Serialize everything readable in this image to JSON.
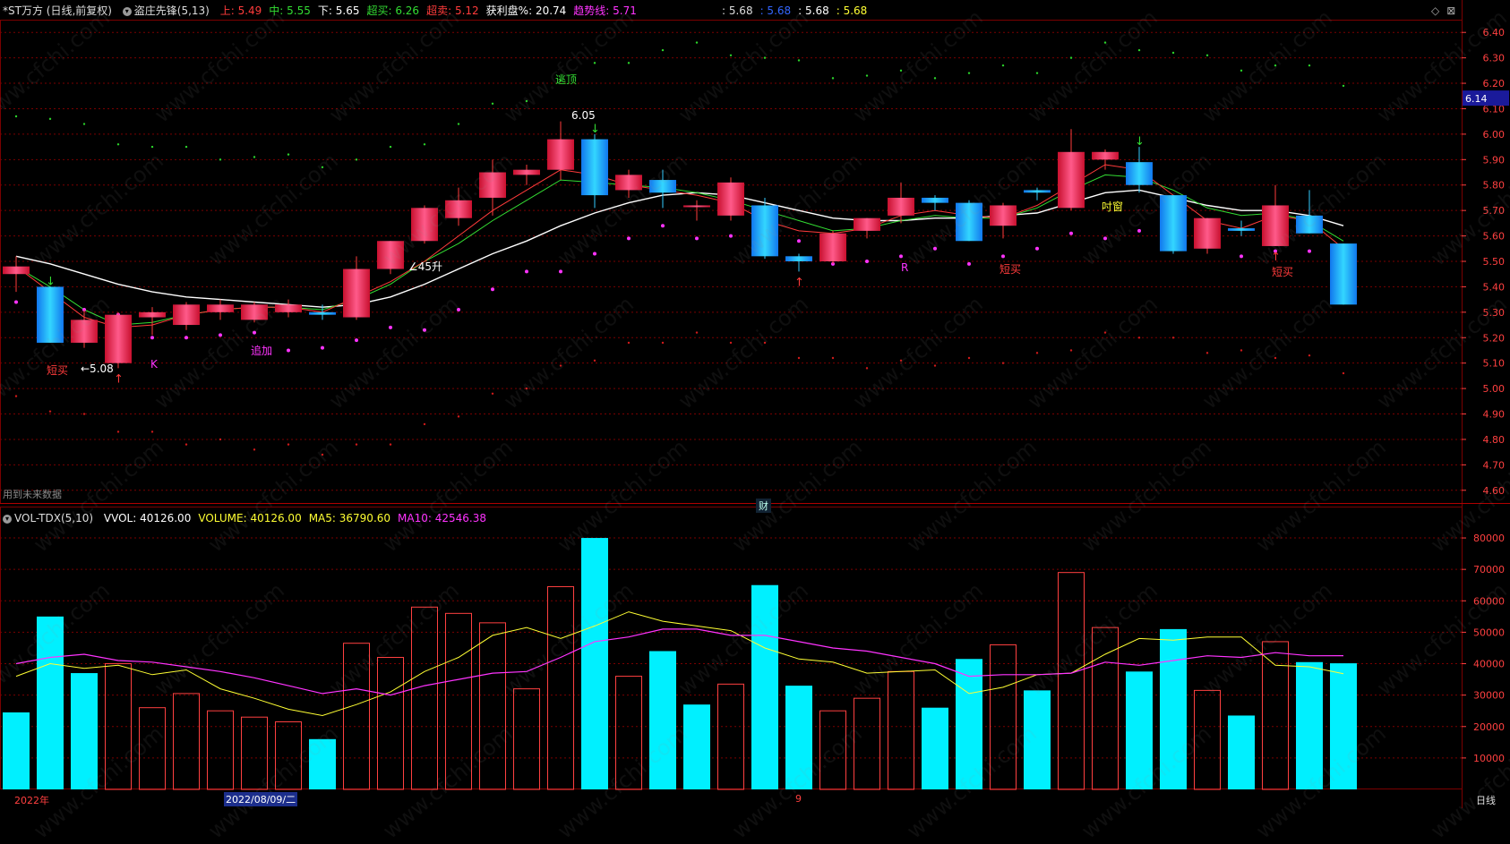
{
  "header_top": {
    "stock": "*ST万方 (日线,前复权)",
    "indicator": "盗庄先锋(5,13)",
    "items": [
      {
        "label": "上:",
        "value": "5.49",
        "color": "#ff3b3b"
      },
      {
        "label": "中:",
        "value": "5.55",
        "color": "#33dd33"
      },
      {
        "label": "下:",
        "value": "5.65",
        "color": "#ffffff"
      },
      {
        "label": "超买:",
        "value": "6.26",
        "color": "#33dd33"
      },
      {
        "label": "超卖:",
        "value": "5.12",
        "color": "#ff3b3b"
      },
      {
        "label": "获利盘%:",
        "value": "20.74",
        "color": "#ffffff"
      },
      {
        "label": "趋势线:",
        "value": "5.71",
        "color": "#ff33ff"
      }
    ],
    "right_values": [
      {
        "text": ": 5.68",
        "color": "#dddddd"
      },
      {
        "text": ": 5.68",
        "color": "#3366ff"
      },
      {
        "text": ": 5.68",
        "color": "#ffffff"
      },
      {
        "text": ": 5.68",
        "color": "#ffff33"
      }
    ]
  },
  "header_vol": {
    "indicator": "VOL-TDX(5,10)",
    "items": [
      {
        "label": "VVOL:",
        "value": "40126.00",
        "color": "#ffffff"
      },
      {
        "label": "VOLUME:",
        "value": "40126.00",
        "color": "#ffff33"
      },
      {
        "label": "MA5:",
        "value": "36790.60",
        "color": "#ffff33"
      },
      {
        "label": "MA10:",
        "value": "42546.38",
        "color": "#ff33ff"
      }
    ]
  },
  "price_axis": [
    "6.40",
    "6.30",
    "6.20",
    "6.10",
    "6.00",
    "5.90",
    "5.80",
    "5.70",
    "5.60",
    "5.50",
    "5.40",
    "5.30",
    "5.20",
    "5.10",
    "5.00",
    "4.90",
    "4.80",
    "4.70",
    "4.60"
  ],
  "current_price": "6.14",
  "vol_axis": [
    "80000",
    "70000",
    "60000",
    "50000",
    "40000",
    "30000",
    "20000",
    "10000"
  ],
  "x_labels": {
    "left": "2022年",
    "selected": "2022/08/09/二",
    "month": "9",
    "right": "日线"
  },
  "notes": {
    "future_data": "用到未来数据",
    "finance": "财"
  },
  "annotations": [
    {
      "text": "逃顶",
      "color": "#33dd33"
    },
    {
      "text": "6.05",
      "color": "#ffffff"
    },
    {
      "text": "短买",
      "color": "#ff3b3b"
    },
    {
      "text": "←5.08",
      "color": "#ffffff"
    },
    {
      "text": "K",
      "color": "#ff33ff"
    },
    {
      "text": "追加",
      "color": "#ff33ff"
    },
    {
      "text": "∠45升",
      "color": "#ffffff"
    },
    {
      "text": "R",
      "color": "#ff33ff"
    },
    {
      "text": "短买",
      "color": "#ff3b3b"
    },
    {
      "text": "吋窗",
      "color": "#ffff33"
    },
    {
      "text": "短买",
      "color": "#ff3b3b"
    }
  ],
  "watermark": "www.cfchi.com",
  "colors": {
    "up": "#ff3b3b",
    "down": "#00e5ff",
    "grid": "#7a0000",
    "axis_text": "#ff4040",
    "ma_white": "#ffffff",
    "ma_green": "#33dd33",
    "ma_red": "#ff3b3b",
    "vol_ma5": "#ffff33",
    "vol_ma10": "#ff33ff"
  },
  "chart_data": [
    {
      "type": "candlestick",
      "title": "*ST万方 (日线,前复权)",
      "ylim": [
        4.55,
        6.45
      ],
      "candles": [
        {
          "o": 5.45,
          "h": 5.52,
          "l": 5.38,
          "c": 5.48
        },
        {
          "o": 5.4,
          "h": 5.4,
          "l": 5.18,
          "c": 5.18
        },
        {
          "o": 5.18,
          "h": 5.31,
          "l": 5.16,
          "c": 5.27
        },
        {
          "o": 5.1,
          "h": 5.3,
          "l": 5.08,
          "c": 5.29
        },
        {
          "o": 5.28,
          "h": 5.32,
          "l": 5.21,
          "c": 5.3
        },
        {
          "o": 5.25,
          "h": 5.34,
          "l": 5.23,
          "c": 5.33
        },
        {
          "o": 5.3,
          "h": 5.35,
          "l": 5.27,
          "c": 5.33
        },
        {
          "o": 5.27,
          "h": 5.34,
          "l": 5.26,
          "c": 5.33
        },
        {
          "o": 5.3,
          "h": 5.35,
          "l": 5.28,
          "c": 5.33
        },
        {
          "o": 5.3,
          "h": 5.33,
          "l": 5.27,
          "c": 5.29
        },
        {
          "o": 5.28,
          "h": 5.52,
          "l": 5.27,
          "c": 5.47
        },
        {
          "o": 5.47,
          "h": 5.58,
          "l": 5.45,
          "c": 5.58
        },
        {
          "o": 5.58,
          "h": 5.72,
          "l": 5.57,
          "c": 5.71
        },
        {
          "o": 5.67,
          "h": 5.79,
          "l": 5.64,
          "c": 5.74
        },
        {
          "o": 5.75,
          "h": 5.9,
          "l": 5.68,
          "c": 5.85
        },
        {
          "o": 5.84,
          "h": 5.88,
          "l": 5.8,
          "c": 5.86
        },
        {
          "o": 5.86,
          "h": 6.05,
          "l": 5.82,
          "c": 5.98
        },
        {
          "o": 5.98,
          "h": 6.0,
          "l": 5.71,
          "c": 5.76
        },
        {
          "o": 5.78,
          "h": 5.86,
          "l": 5.75,
          "c": 5.84
        },
        {
          "o": 5.82,
          "h": 5.86,
          "l": 5.71,
          "c": 5.77
        },
        {
          "o": 5.72,
          "h": 5.74,
          "l": 5.66,
          "c": 5.72
        },
        {
          "o": 5.68,
          "h": 5.83,
          "l": 5.66,
          "c": 5.81
        },
        {
          "o": 5.72,
          "h": 5.75,
          "l": 5.51,
          "c": 5.52
        },
        {
          "o": 5.52,
          "h": 5.53,
          "l": 5.46,
          "c": 5.5
        },
        {
          "o": 5.5,
          "h": 5.62,
          "l": 5.49,
          "c": 5.61
        },
        {
          "o": 5.62,
          "h": 5.67,
          "l": 5.59,
          "c": 5.67
        },
        {
          "o": 5.68,
          "h": 5.81,
          "l": 5.65,
          "c": 5.75
        },
        {
          "o": 5.75,
          "h": 5.76,
          "l": 5.7,
          "c": 5.73
        },
        {
          "o": 5.73,
          "h": 5.74,
          "l": 5.58,
          "c": 5.58
        },
        {
          "o": 5.64,
          "h": 5.73,
          "l": 5.59,
          "c": 5.72
        },
        {
          "o": 5.78,
          "h": 5.79,
          "l": 5.74,
          "c": 5.77
        },
        {
          "o": 5.71,
          "h": 6.02,
          "l": 5.7,
          "c": 5.93
        },
        {
          "o": 5.9,
          "h": 5.94,
          "l": 5.86,
          "c": 5.93
        },
        {
          "o": 5.89,
          "h": 5.95,
          "l": 5.77,
          "c": 5.8
        },
        {
          "o": 5.76,
          "h": 5.76,
          "l": 5.53,
          "c": 5.54
        },
        {
          "o": 5.55,
          "h": 5.67,
          "l": 5.53,
          "c": 5.67
        },
        {
          "o": 5.63,
          "h": 5.66,
          "l": 5.6,
          "c": 5.62
        },
        {
          "o": 5.56,
          "h": 5.8,
          "l": 5.56,
          "c": 5.72
        },
        {
          "o": 5.68,
          "h": 5.78,
          "l": 5.61,
          "c": 5.61
        },
        {
          "o": 5.57,
          "h": 5.57,
          "l": 5.33,
          "c": 5.33
        }
      ],
      "ma_white": [
        5.52,
        5.49,
        5.45,
        5.41,
        5.38,
        5.36,
        5.35,
        5.34,
        5.33,
        5.32,
        5.33,
        5.36,
        5.41,
        5.47,
        5.53,
        5.58,
        5.64,
        5.69,
        5.73,
        5.76,
        5.77,
        5.76,
        5.73,
        5.7,
        5.67,
        5.66,
        5.66,
        5.67,
        5.67,
        5.68,
        5.69,
        5.73,
        5.77,
        5.78,
        5.75,
        5.72,
        5.7,
        5.7,
        5.68,
        5.64
      ],
      "ma_green": [
        5.48,
        5.4,
        5.31,
        5.25,
        5.26,
        5.29,
        5.31,
        5.32,
        5.32,
        5.31,
        5.35,
        5.41,
        5.5,
        5.57,
        5.66,
        5.74,
        5.82,
        5.81,
        5.8,
        5.79,
        5.77,
        5.74,
        5.7,
        5.66,
        5.62,
        5.63,
        5.66,
        5.68,
        5.67,
        5.67,
        5.71,
        5.78,
        5.84,
        5.83,
        5.78,
        5.71,
        5.68,
        5.69,
        5.66,
        5.58
      ],
      "ma_red": [
        5.48,
        5.38,
        5.28,
        5.24,
        5.25,
        5.29,
        5.31,
        5.32,
        5.32,
        5.3,
        5.36,
        5.42,
        5.5,
        5.6,
        5.7,
        5.78,
        5.86,
        5.84,
        5.8,
        5.78,
        5.76,
        5.73,
        5.66,
        5.62,
        5.61,
        5.63,
        5.68,
        5.7,
        5.68,
        5.67,
        5.72,
        5.8,
        5.88,
        5.86,
        5.76,
        5.66,
        5.63,
        5.68,
        5.66,
        5.55
      ]
    },
    {
      "type": "bar",
      "title": "VOL-TDX(5,10)",
      "ylim": [
        0,
        84000
      ],
      "values": [
        24500,
        55000,
        37000,
        40000,
        26000,
        30500,
        25000,
        23000,
        21500,
        16000,
        46500,
        42000,
        58000,
        56000,
        53000,
        32000,
        64500,
        80000,
        36000,
        44000,
        27000,
        33500,
        65000,
        33000,
        25000,
        29000,
        37500,
        26000,
        41500,
        46000,
        31500,
        69000,
        51500,
        37500,
        51000,
        31500,
        23500,
        47000,
        40500,
        40126
      ],
      "up": [
        false,
        false,
        false,
        true,
        true,
        true,
        true,
        true,
        true,
        false,
        true,
        true,
        true,
        true,
        true,
        true,
        true,
        false,
        true,
        false,
        false,
        true,
        false,
        false,
        true,
        true,
        true,
        false,
        false,
        true,
        false,
        true,
        true,
        false,
        false,
        true,
        false,
        true,
        false,
        false
      ],
      "ma5": [
        36000,
        40000,
        38500,
        39500,
        36500,
        38000,
        32000,
        29000,
        25500,
        23500,
        27000,
        31000,
        37500,
        42000,
        49000,
        51500,
        48000,
        52000,
        56500,
        53500,
        52000,
        50500,
        45000,
        41500,
        40500,
        37000,
        37500,
        38000,
        30500,
        32500,
        36500,
        37000,
        43000,
        48000,
        47500,
        48500,
        48500,
        39500,
        39000,
        36790
      ]
    },
    {
      "type": "line",
      "name": "MA10",
      "values": [
        40000,
        42000,
        43000,
        41000,
        40500,
        39000,
        37500,
        35500,
        33000,
        30500,
        32000,
        30000,
        33000,
        35000,
        37000,
        37500,
        42000,
        47000,
        48500,
        51000,
        51000,
        49000,
        49000,
        47000,
        45000,
        44000,
        42000,
        40000,
        36000,
        36500,
        36500,
        37000,
        40500,
        39500,
        41000,
        42500,
        42000,
        43500,
        42500,
        42546
      ]
    }
  ]
}
